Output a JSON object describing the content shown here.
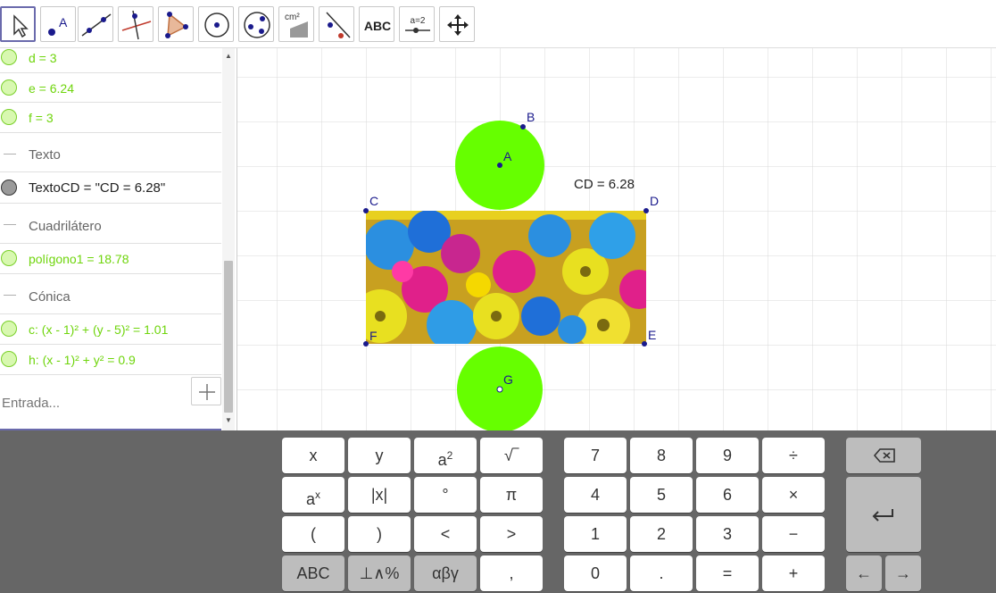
{
  "toolbar": {
    "tools": [
      {
        "name": "move-tool",
        "active": true
      },
      {
        "name": "point-tool",
        "letter": "A"
      },
      {
        "name": "line-tool"
      },
      {
        "name": "perpendicular-tool"
      },
      {
        "name": "polygon-tool"
      },
      {
        "name": "circle-center-point-tool"
      },
      {
        "name": "circle-three-points-tool"
      },
      {
        "name": "area-tool",
        "label": "cm²"
      },
      {
        "name": "reflect-tool"
      },
      {
        "name": "text-tool",
        "label": "ABC"
      },
      {
        "name": "slider-tool",
        "label": "a=2"
      },
      {
        "name": "move-graphics-view-tool"
      }
    ]
  },
  "algebra": {
    "rows": [
      {
        "text": "d = 3",
        "color": "green"
      },
      {
        "text": "e = 6.24",
        "color": "green"
      },
      {
        "text": "f = 3",
        "color": "green"
      }
    ],
    "cat_texto": "Texto",
    "texto_row": "TextoCD = \"CD = 6.28\"",
    "cat_cuadrilatero": "Cuadrilátero",
    "poligono_row": "polígono1 = 18.78",
    "cat_conica": "Cónica",
    "conica_c": "c: (x - 1)² + (y - 5)² = 1.01",
    "conica_h": "h: (x - 1)² + y² = 0.9",
    "input_placeholder": "Entrada..."
  },
  "graphics": {
    "grid_color": "#d9d9d9",
    "circle_color": "#66ff00",
    "point_color": "#1a1a8c",
    "labels": {
      "A": "A",
      "B": "B",
      "C": "C",
      "D": "D",
      "E": "E",
      "F": "F",
      "G": "G"
    },
    "text_cd": "CD = 6.28"
  },
  "keyboard": {
    "x": "x",
    "y": "y",
    "a2_base": "a",
    "a2_sup": "2",
    "sqrt": "√",
    "ax_base": "a",
    "ax_sup": "x",
    "abs": "|x|",
    "deg": "°",
    "pi": "π",
    "lparen": "(",
    "rparen": ")",
    "lt": "<",
    "gt": ">",
    "abc": "ABC",
    "ops": "⊥∧%",
    "greek": "αβγ",
    "comma": ",",
    "n7": "7",
    "n8": "8",
    "n9": "9",
    "div": "÷",
    "n4": "4",
    "n5": "5",
    "n6": "6",
    "mul": "×",
    "n1": "1",
    "n2": "2",
    "n3": "3",
    "minus": "−",
    "n0": "0",
    "dot": ".",
    "eq": "=",
    "plus": "+",
    "backspace": "⌫",
    "enter": "↵",
    "left": "←",
    "right": "→"
  }
}
